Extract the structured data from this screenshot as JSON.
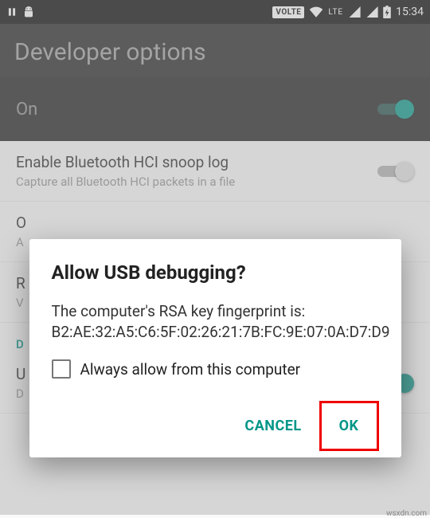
{
  "statusbar": {
    "badges": {
      "volte": "VOLTE",
      "lte": "LTE"
    },
    "time": "15:34"
  },
  "appbar": {
    "title": "Developer options"
  },
  "master": {
    "label": "On"
  },
  "rows": {
    "bt_snoop": {
      "title": "Enable Bluetooth HCI snoop log",
      "sub": "Capture all Bluetooth HCI packets in a file"
    },
    "oem": {
      "title_initial": "O",
      "sub_initial": "A"
    },
    "running": {
      "title_initial": "R",
      "sub_initial": "V"
    },
    "usb": {
      "title_initial": "U",
      "sub_initial": "D"
    }
  },
  "category": {
    "debugging": "D"
  },
  "dialog": {
    "title": "Allow USB debugging?",
    "body": "The computer's RSA key fingerprint is:\nB2:AE:32:A5:C6:5F:02:26:21:7B:FC:9E:07:0A:D7:D9",
    "checkbox_label": "Always allow from this computer",
    "cancel": "CANCEL",
    "ok": "OK"
  },
  "watermark": "wsxdn.com"
}
